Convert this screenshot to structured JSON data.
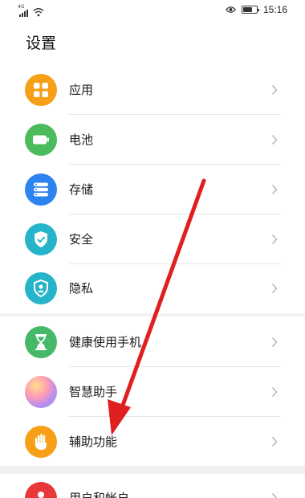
{
  "status_bar": {
    "network": "4G",
    "time": "15:16",
    "battery_level": 0.7
  },
  "header": {
    "title": "设置"
  },
  "groups": [
    {
      "items": [
        {
          "label": "应用",
          "icon": "apps-grid-icon",
          "color": "#f5a016"
        },
        {
          "label": "电池",
          "icon": "battery-icon",
          "color": "#4cbb5c"
        },
        {
          "label": "存储",
          "icon": "storage-icon",
          "color": "#2c84f0"
        },
        {
          "label": "安全",
          "icon": "shield-check-icon",
          "color": "#25b4c9"
        },
        {
          "label": "隐私",
          "icon": "privacy-shield-icon",
          "color": "#25b4c9"
        }
      ]
    },
    {
      "items": [
        {
          "label": "健康使用手机",
          "icon": "hourglass-icon",
          "color": "#46b868"
        },
        {
          "label": "智慧助手",
          "icon": "smart-assistant-icon",
          "color": "#c58be0"
        },
        {
          "label": "辅助功能",
          "icon": "hand-icon",
          "color": "#f5a016"
        }
      ]
    },
    {
      "items": [
        {
          "label": "用户和帐户",
          "icon": "user-icon",
          "color": "#e8393a"
        }
      ]
    }
  ],
  "annotation": {
    "arrow_color": "#e02020"
  }
}
